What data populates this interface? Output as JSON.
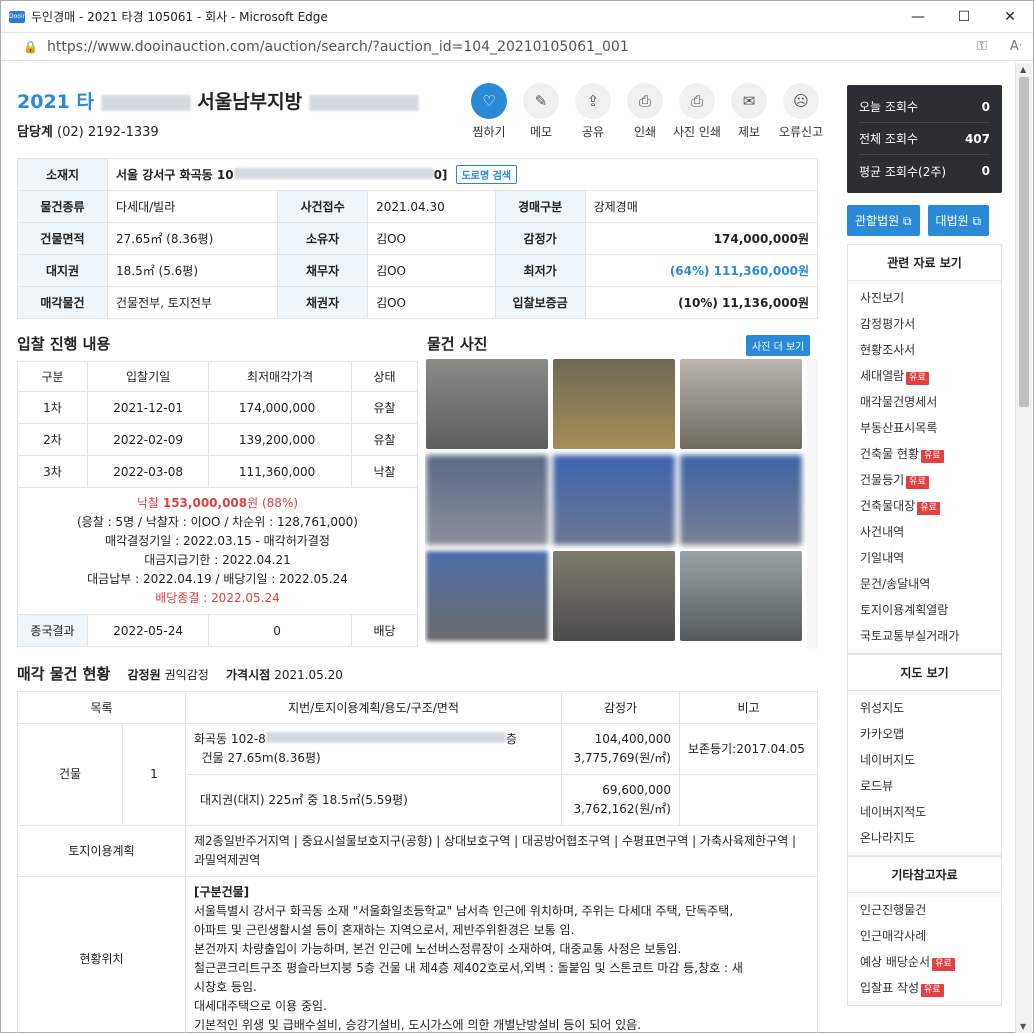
{
  "window": {
    "title": "두인경매 - 2021 타경 105061 - 회사 - Microsoft Edge",
    "url": "https://www.dooinauction.com/auction/search/?auction_id=104_20210105061_001",
    "min": "—",
    "max": "☐",
    "close": "✕"
  },
  "header": {
    "case_prefix": "2021 타",
    "court": "서울남부지방",
    "manager_label": "담당계",
    "manager_phone": "(02) 2192-1339"
  },
  "actions": [
    {
      "label": "찜하기",
      "icon": "♡"
    },
    {
      "label": "메모",
      "icon": "✎"
    },
    {
      "label": "공유",
      "icon": "⇪"
    },
    {
      "label": "인쇄",
      "icon": "⎙"
    },
    {
      "label": "사진 인쇄",
      "icon": "⎙"
    },
    {
      "label": "제보",
      "icon": "✉"
    },
    {
      "label": "오류신고",
      "icon": "☹"
    }
  ],
  "info": {
    "location_label": "소재지",
    "location_value": "서울 강서구 화곡동 10",
    "location_suffix": "0]",
    "road_search": "도로명 검색",
    "rows": [
      [
        "물건종류",
        "다세대/빌라",
        "사건접수",
        "2021.04.30",
        "경매구분",
        "강제경매"
      ],
      [
        "건물면적",
        "27.65㎡ (8.36평)",
        "소유자",
        "김OO",
        "감정가",
        "174,000,000원"
      ],
      [
        "대지권",
        "18.5㎡ (5.6평)",
        "채무자",
        "김OO",
        "최저가",
        "(64%) 111,360,000원"
      ],
      [
        "매각물건",
        "건물전부, 토지전부",
        "채권자",
        "김OO",
        "입찰보증금",
        "(10%) 11,136,000원"
      ]
    ]
  },
  "bidding": {
    "title": "입찰 진행 내용",
    "headers": [
      "구분",
      "입찰기일",
      "최저매각가격",
      "상태"
    ],
    "rows": [
      [
        "1차",
        "2021-12-01",
        "174,000,000",
        "유찰"
      ],
      [
        "2차",
        "2022-02-09",
        "139,200,000",
        "유찰"
      ],
      [
        "3차",
        "2022-03-08",
        "111,360,000",
        "낙찰"
      ]
    ],
    "result_line1_a": "낙찰 ",
    "result_line1_b": "153,000,008",
    "result_line1_c": "원 (",
    "result_line1_d": "88%",
    "result_line1_e": ")",
    "result_line2": "(응찰 : 5명 / 낙찰자 : 이OO / 차순위 : 128,761,000)",
    "result_line3": "매각결정기일 : 2022.03.15 - 매각허가결정",
    "result_line4": "대금지급기한 : 2022.04.21",
    "result_line5": "대금납부 : 2022.04.19 / 배당기일 : 2022.05.24",
    "result_line6": "배당종결 : 2022.05.24",
    "final": [
      "종국결과",
      "2022-05-24",
      "0",
      "배당"
    ]
  },
  "photos": {
    "title": "물건 사진",
    "more": "사진 더 보기"
  },
  "property": {
    "title": "매각 물건 현황",
    "appraiser_label": "감정원",
    "appraiser": "권익감정",
    "price_date_label": "가격시점",
    "price_date": "2021.05.20",
    "headers": [
      "목록",
      "지번/토지이용계획/용도/구조/면적",
      "감정가",
      "비고"
    ],
    "building_label": "건물",
    "building_no": "1",
    "b_row1_a": "화곡동 102-8",
    "b_row1_b": "층",
    "b_row1_c": "건물 27.65m",
    "b_row1_d": "(8.36평)",
    "b_row1_price1": "104,400,000",
    "b_row1_price2": "3,775,769(원/㎡)",
    "b_row1_note": "보존등기:2017.04.05",
    "b_row2": "대지권(대지) 225㎡ 중 18.5㎡(5.59평)",
    "b_row2_price1": "69,600,000",
    "b_row2_price2": "3,762,162(원/㎡)",
    "land_label": "토지이용계획",
    "land_value": "제2종일반주거지역 | 중요시설물보호지구(공항) | 상대보호구역 | 대공방어협조구역 | 수평표면구역 | 가축사육제한구역 | 과밀억제권역",
    "loc_label": "현황위치",
    "loc_title": "[구분건물]",
    "loc_lines": [
      "서울특별시 강서구 화곡동 소재 \"서울화일초등학교\" 남서측 인근에 위치하며, 주위는 다세대 주택, 단독주택,",
      "아파트 및 근린생활시설 등이 혼재하는 지역으로서, 제반주위환경은 보통 임.",
      "본건까지 차량출입이 가능하며, 본건 인근에 노선버스정류장이 소재하여, 대중교통 사정은 보통임.",
      "철근콘크리트구조 평슬라브지붕 5층 건물 내 제4층 제402호로서,외벽 : 돌붙임 및 스톤코트 마감 등,창호 : 새",
      "시창호 등임.",
      "대세대주택으로 이용 중임.",
      "기본적인 위생 및 급배수설비, 승강기설비, 도시가스에 의한 개별난방설비 등이 되어 있음."
    ]
  },
  "sidebar": {
    "today_label": "오늘 조회수",
    "today": "0",
    "total_label": "전체 조회수",
    "total": "407",
    "avg_label": "평균 조회수(2주)",
    "avg": "0",
    "court1": "관할법원 ⧉",
    "court2": "대법원 ⧉",
    "related_title": "관련 자료 보기",
    "related": [
      {
        "label": "사진보기",
        "tag": ""
      },
      {
        "label": "감정평가서",
        "tag": ""
      },
      {
        "label": "현황조사서",
        "tag": ""
      },
      {
        "label": "세대열람",
        "tag": "유료"
      },
      {
        "label": "매각물건명세서",
        "tag": ""
      },
      {
        "label": "부동산표시목록",
        "tag": ""
      },
      {
        "label": "건축물 현황",
        "tag": "유료"
      },
      {
        "label": "건물등기",
        "tag": "유료"
      },
      {
        "label": "건축물대장",
        "tag": "유료"
      },
      {
        "label": "사건내역",
        "tag": ""
      },
      {
        "label": "기일내역",
        "tag": ""
      },
      {
        "label": "문건/송달내역",
        "tag": ""
      },
      {
        "label": "토지이용계획열람",
        "tag": ""
      },
      {
        "label": "국토교통부실거래가",
        "tag": ""
      }
    ],
    "map_title": "지도 보기",
    "maps": [
      "위성지도",
      "카카오맵",
      "네이버지도",
      "로드뷰",
      "네이버지적도",
      "온나라지도"
    ],
    "etc_title": "기타참고자료",
    "etc": [
      {
        "label": "인근진행물건",
        "tag": ""
      },
      {
        "label": "인근매각사례",
        "tag": ""
      },
      {
        "label": "예상 배당순서",
        "tag": "유료"
      },
      {
        "label": "입찰표 작성",
        "tag": "유료"
      }
    ]
  }
}
